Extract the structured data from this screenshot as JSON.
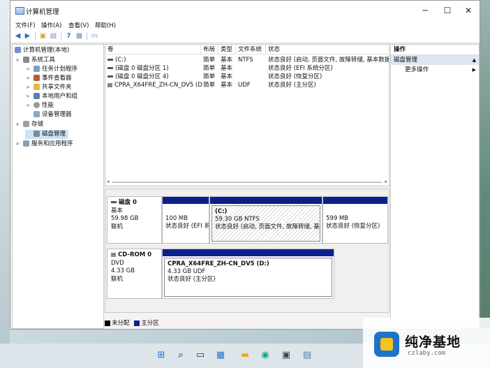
{
  "window": {
    "title": "计算机管理",
    "controls": {
      "minimize": "─",
      "maximize": "☐",
      "close": "✕"
    }
  },
  "menu": [
    "文件(F)",
    "操作(A)",
    "查看(V)",
    "帮助(H)"
  ],
  "tree": {
    "root": "计算机管理(本地)",
    "system_tools": "系统工具",
    "task_scheduler": "任务计划程序",
    "event_viewer": "事件查看器",
    "shared_folders": "共享文件夹",
    "local_users": "本地用户和组",
    "performance": "性能",
    "device_manager": "设备管理器",
    "storage": "存储",
    "disk_management": "磁盘管理",
    "services_apps": "服务和应用程序"
  },
  "volume_list": {
    "headers": [
      "卷",
      "布局",
      "类型",
      "文件系统",
      "状态"
    ],
    "rows": [
      {
        "volume": "(C:)",
        "layout": "简单",
        "type": "基本",
        "fs": "NTFS",
        "status": "状态良好 (启动, 页面文件, 故障转储, 基本数据分"
      },
      {
        "volume": "(磁盘 0 磁盘分区 1)",
        "layout": "简单",
        "type": "基本",
        "fs": "",
        "status": "状态良好 (EFI 系统分区)"
      },
      {
        "volume": "(磁盘 0 磁盘分区 4)",
        "layout": "简单",
        "type": "基本",
        "fs": "",
        "status": "状态良好 (恢复分区)"
      },
      {
        "volume": "CPRA_X64FRE_ZH-CN_DV5 (D:)",
        "layout": "简单",
        "type": "基本",
        "fs": "UDF",
        "status": "状态良好 (主分区)"
      }
    ]
  },
  "disks": [
    {
      "name": "磁盘 0",
      "type": "基本",
      "size": "59.98 GB",
      "state": "联机",
      "partitions": [
        {
          "title": "",
          "size": "100 MB",
          "status": "状态良好 (EFI 系"
        },
        {
          "title": "(C:)",
          "size": "59.30 GB NTFS",
          "status": "状态良好 (启动, 页面文件, 故障转储, 基本"
        },
        {
          "title": "",
          "size": "599 MB",
          "status": "状态良好 (恢复分区)"
        }
      ]
    },
    {
      "name": "CD-ROM 0",
      "type": "DVD",
      "size": "4.33 GB",
      "state": "联机",
      "partitions": [
        {
          "title": "CPRA_X64FRE_ZH-CN_DV5  (D:)",
          "size": "4.33 GB UDF",
          "status": "状态良好 (主分区)"
        }
      ]
    }
  ],
  "legend": {
    "unallocated": "未分配",
    "primary": "主分区"
  },
  "actions": {
    "header": "操作",
    "section": "磁盘管理",
    "more": "更多操作"
  },
  "colors": {
    "primary_partition": "#0b1f8c",
    "selection": "#cce4f7",
    "action_section": "#dbe7f3"
  },
  "watermark": {
    "title": "纯净基地",
    "sub": "czlaby.com"
  },
  "taskbar_icons": [
    "windows-start-icon",
    "search-icon",
    "task-view-icon",
    "widgets-icon",
    "file-explorer-icon",
    "edge-icon",
    "store-icon",
    "computer-management-icon"
  ]
}
